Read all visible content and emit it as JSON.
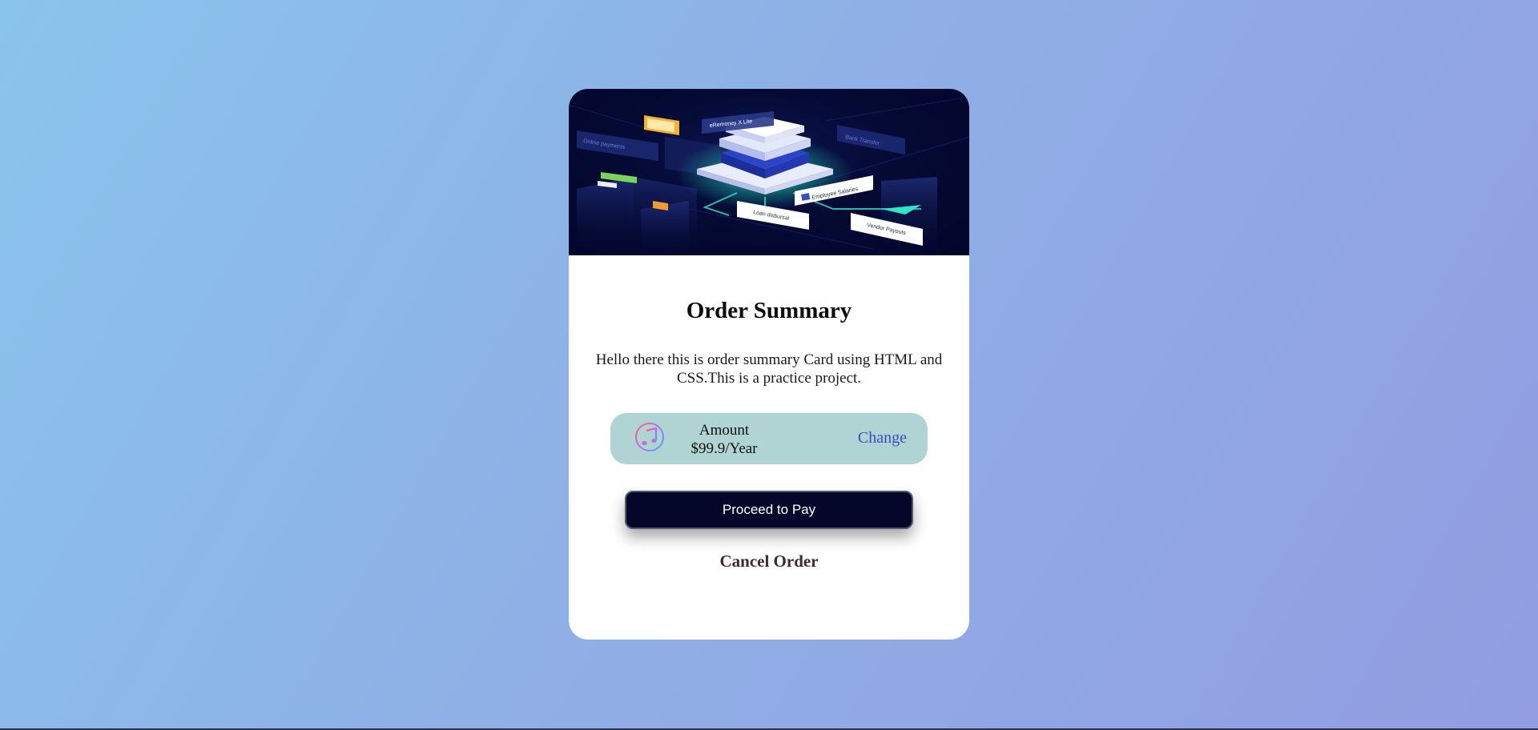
{
  "card": {
    "title": "Order Summary",
    "description": "Hello there this is order summary Card using HTML and CSS.This is a practice project.",
    "plan": {
      "icon": "music-note-icon",
      "label": "Amount",
      "price": "$99.9/Year",
      "change_label": "Change"
    },
    "pay_button": "Proceed to Pay",
    "cancel_link": "Cancel Order"
  },
  "hero": {
    "alt": "isometric payments illustration"
  },
  "colors": {
    "background_start": "#89c4ec",
    "background_end": "#929de2",
    "card": "#ffffff",
    "hero_dark": "#03062a",
    "plan_bg": "#afd4d3",
    "change_link": "#3a4fbf",
    "pay_button": "#04062a"
  }
}
